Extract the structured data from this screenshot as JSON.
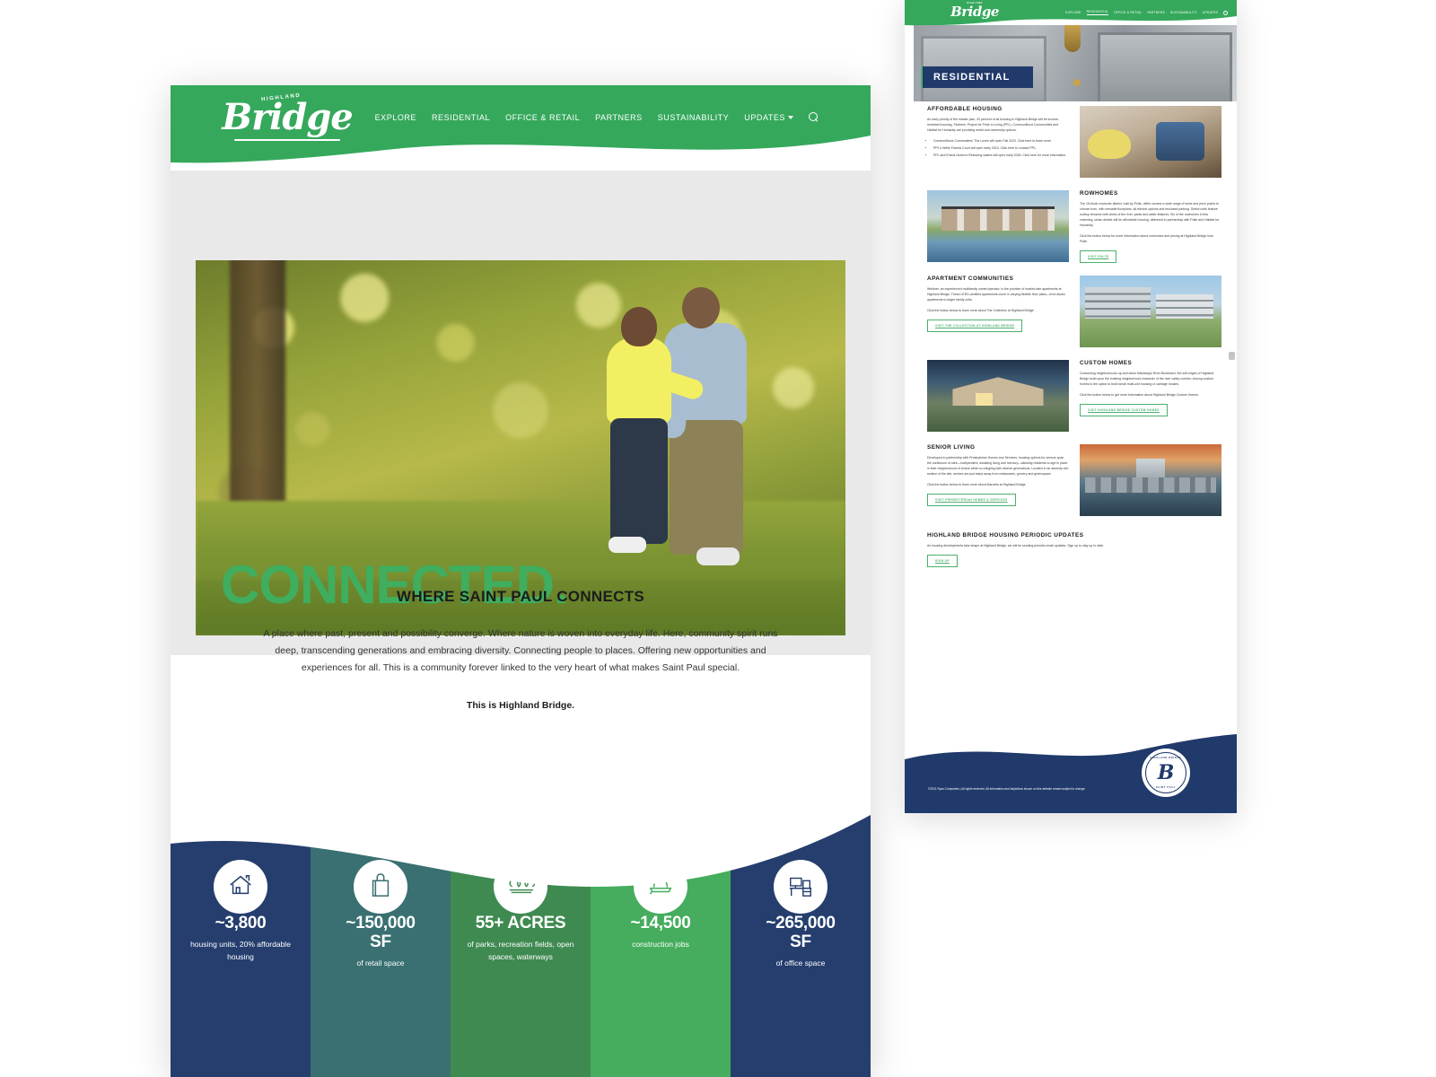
{
  "site": {
    "brand_sup": "HIGHLAND",
    "brand_name": "Bridge",
    "nav": [
      {
        "label": "EXPLORE"
      },
      {
        "label": "RESIDENTIAL"
      },
      {
        "label": "OFFICE & RETAIL"
      },
      {
        "label": "PARTNERS"
      },
      {
        "label": "SUSTAINABILITY"
      },
      {
        "label": "UPDATES"
      }
    ],
    "search_icon": "search-icon",
    "colors": {
      "green": "#3fae5f",
      "header_green": "#35a85c",
      "navy": "#253e6e",
      "teal": "#3a7071",
      "mid_green": "#3f8a51",
      "bright_green": "#45ad5d",
      "link_green": "#4caf6d"
    }
  },
  "home": {
    "hero": {
      "headline": "CONNECTED."
    },
    "connects": {
      "heading": "WHERE SAINT PAUL CONNECTS",
      "body": "A place where past, present and possibility converge. Where nature is woven into everyday life. Here, community spirit runs deep, transcending generations and embracing diversity. Connecting people to places. Offering new opportunities and experiences for all. This is a community forever linked to the very heart of what makes Saint Paul special.",
      "tagline": "This is Highland Bridge."
    },
    "stats": [
      {
        "icon": "house-icon",
        "number": "~3,800",
        "desc": "housing units, 20% affordable housing",
        "bg": "#253e6e"
      },
      {
        "icon": "shopping-bag-icon",
        "number": "~150,000\nSF",
        "desc": "of retail space",
        "bg": "#3a7071"
      },
      {
        "icon": "trees-icon",
        "number": "55+ ACRES",
        "desc": "of parks, recreation fields, open spaces, waterways",
        "bg": "#3f8a51"
      },
      {
        "icon": "hard-hat-icon",
        "number": "~14,500",
        "desc": "construction jobs",
        "bg": "#45ad5d"
      },
      {
        "icon": "desk-icon",
        "number": "~265,000\nSF",
        "desc": "of office space",
        "bg": "#253e6e"
      }
    ]
  },
  "residential": {
    "hero_label": "RESIDENTIAL",
    "active_nav": "RESIDENTIAL",
    "sections": [
      {
        "heading": "AFFORDABLE HOUSING",
        "image": "kitchen-family-photo",
        "image_side": "right",
        "paragraphs": [
          "An early priority of the master plan, 20 percent of all housing in Highland Bridge will be income-restricted housing. Partners, Project for Pride in Living (PPL), CommonBond Communities and Habitat for Humanity are providing rental and ownership options."
        ],
        "bullets": [
          "CommonBond Communities' The Lumin will open Fall 2023. Click here to learn more.",
          "PPL's Nellie Francis Court will open early 2024. Click here to contact PPL.",
          "PPL and Emma Norton's Restoring waters will open early 2026. Click here for more information."
        ],
        "button": ""
      },
      {
        "heading": "ROWHOMES",
        "image": "rowhomes-pond-photo",
        "image_side": "left",
        "paragraphs": [
          "The 15-block rowhome district, built by Pulte, offers owners a wide range of sizes and price points to choose from, with versatile floorplans, all-electric options and enclosed parking. Select units feature rooftop terraces with views of the river, parks and water features. Six of the rowhomes in this charming, urban district will be affordable housing, delivered in partnership with Pulte and Habitat for Humanity.",
          "Click the button below for more information about rowhomes and pricing at Highland Bridge from Pulte."
        ],
        "bullets": [],
        "button": "VISIT PULTE"
      },
      {
        "heading": "APARTMENT COMMUNITIES",
        "image": "apartment-buildings-photo",
        "image_side": "right",
        "paragraphs": [
          "Weidner, an experienced multifamily owner/operator, is the provider of market-rate apartments at Highland Bridge. These LEED-certified apartments come in varying flexible floor plans—from studio apartments to larger family units.",
          "Click the button below to learn more about The Collection at Highland Bridge."
        ],
        "bullets": [],
        "button": "VISIT THE COLLECTION AT HIGHLAND BRIDGE"
      },
      {
        "heading": "CUSTOM HOMES",
        "image": "custom-home-photo",
        "image_side": "left",
        "paragraphs": [
          "Connecting neighborhoods up and down Mississippi River Boulevard, the soft edges of Highland Bridge build upon the existing neighborhood character of the river valley corridor. Among custom homes is the option to build small multi-unit housing or carriage houses.",
          "Click the button below to get more information about Highland Bridge Custom Homes."
        ],
        "bullets": [],
        "button": "VISIT HIGHLAND BRIDGE CUSTOM HOMES"
      },
      {
        "heading": "SENIOR LIVING",
        "image": "senior-living-rendering",
        "image_side": "right",
        "paragraphs": [
          "Developed in partnership with Presbyterian Homes and Services, housing options for seniors span the continuum of care—independent, assisting living and memory—allowing residents to age in place in their neighborhood of choice while co-mingling with diverse generations. Located in an amenity-rich section of the site, seniors are just steps away from restaurants, grocery and greenspace.",
          "Click the button below to learn more about Marvella at Highland Bridge."
        ],
        "bullets": [],
        "button": "VISIT PRESBYTERIAN HOMES & SERVICES"
      }
    ],
    "updates": {
      "heading": "HIGHLAND BRIDGE HOUSING PERIODIC UPDATES",
      "body": "As housing developments take shape at Highland Bridge, we will be sending periodic email updates. Sign up to stay up to date.",
      "button": "SIGN UP"
    },
    "footer": {
      "copyright": "©2021 Ryan Companies | All rights reserved. All information and depictions shown on this website remain subject to change.",
      "badge_top": "HIGHLAND BRIDGE",
      "badge_letter": "B",
      "badge_bottom": "SAINT PAUL"
    }
  }
}
